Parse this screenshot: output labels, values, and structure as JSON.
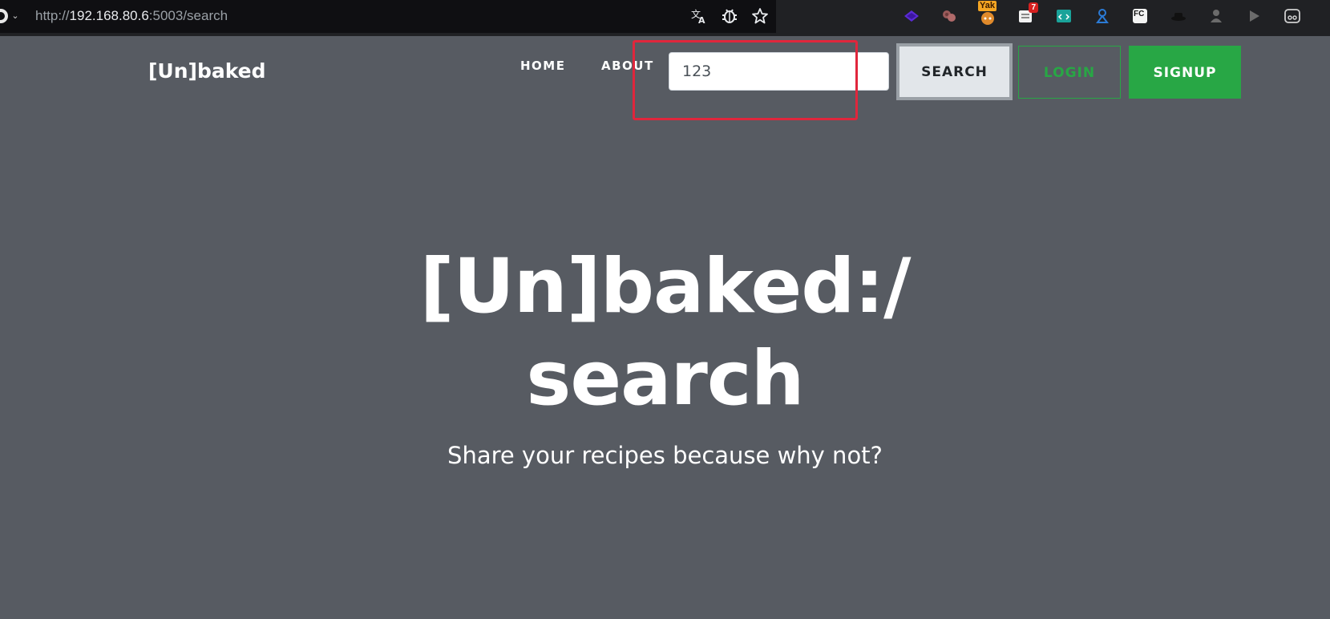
{
  "browser": {
    "url_scheme": "http://",
    "url_host": "192.168.80.6",
    "url_rest": ":5003/search",
    "icons": [
      "site-info-icon",
      "chevron-down-icon",
      "translate-icon",
      "bug-icon",
      "star-icon"
    ],
    "extensions": {
      "yak_label": "Yak",
      "notification_count": "7",
      "fc_label": "FC"
    }
  },
  "navbar": {
    "brand": "[Un]baked",
    "links": [
      "HOME",
      "ABOUT"
    ],
    "search_value": "123",
    "search_button": "SEARCH",
    "login_button": "LOGIN",
    "signup_button": "SIGNUP"
  },
  "hero": {
    "title_line1": "[Un]baked:/",
    "title_line2": "search",
    "subtitle": "Share your recipes because why not?"
  },
  "colors": {
    "page_background": "#575b62",
    "browser_bar": "#202124",
    "success_green": "#28a745",
    "annotation_red": "#e0263c"
  }
}
